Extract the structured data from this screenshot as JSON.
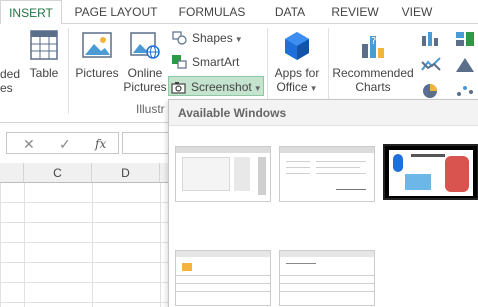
{
  "tabs": [
    {
      "label": "INSERT",
      "active": true
    },
    {
      "label": "PAGE LAYOUT",
      "active": false
    },
    {
      "label": "FORMULAS",
      "active": false
    },
    {
      "label": "DATA",
      "active": false
    },
    {
      "label": "REVIEW",
      "active": false
    },
    {
      "label": "VIEW",
      "active": false
    }
  ],
  "ribbon": {
    "recommended_tables_partial_top": "ded",
    "recommended_tables_partial_bottom": "es",
    "table": "Table",
    "pictures": "Pictures",
    "online_pictures_line1": "Online",
    "online_pictures_line2": "Pictures",
    "shapes": "Shapes",
    "smartart": "SmartArt",
    "screenshot": "Screenshot",
    "group_illustrations_partial": "Illustr",
    "apps_line1": "Apps for",
    "apps_line2": "Office",
    "recommended_charts_line1": "Recommended",
    "recommended_charts_line2": "Charts"
  },
  "formula_bar": {
    "cancel_glyph": "✕",
    "enter_glyph": "✓",
    "fx_label": "fx"
  },
  "columns": [
    "C",
    "D"
  ],
  "screenshot_panel": {
    "heading": "Available Windows",
    "thumbnails": [
      {
        "name": "window-1",
        "dark": false
      },
      {
        "name": "window-2",
        "dark": false
      },
      {
        "name": "window-3",
        "dark": true
      },
      {
        "name": "window-4",
        "dark": false
      },
      {
        "name": "window-5",
        "dark": false
      }
    ]
  },
  "colors": {
    "accent": "#217346",
    "selected_button_bg": "#c5e4cf",
    "apps_icon": "#1e6fd9"
  }
}
